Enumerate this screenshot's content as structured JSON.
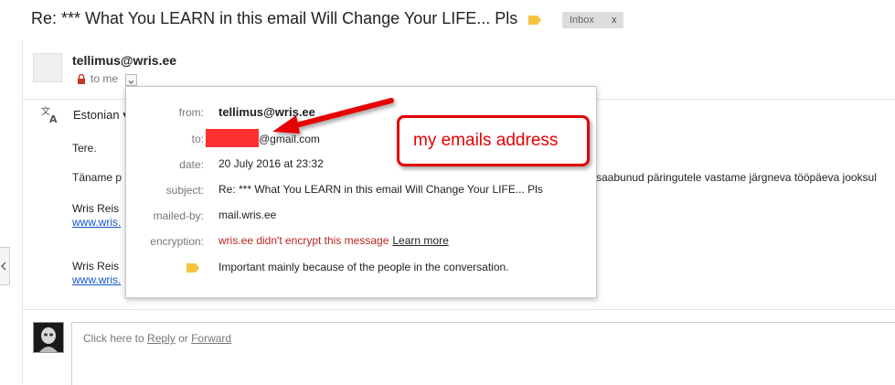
{
  "subject": {
    "title": "Re: *** What You LEARN in this email Will Change Your LIFE... Pls",
    "badge_label": "Inbox",
    "badge_close": "x"
  },
  "header": {
    "sender": "tellimus@wris.ee",
    "to_label": "to me"
  },
  "translate": {
    "language": "Estonian ▾"
  },
  "body": {
    "greeting": "Tere.",
    "line1_start": "Täname p",
    "line1_end": "saabunud päringutele vastame järgneva tööpäeva jooksul",
    "sig1_name": "Wris Reis",
    "sig1_link": "www.wris.",
    "sig2_name": "Wris Reis",
    "sig2_link": "www.wris."
  },
  "details": {
    "from_label": "from:",
    "from_value": "tellimus@wris.ee",
    "to_label": "to:",
    "to_value_suffix": "@gmail.com",
    "date_label": "date:",
    "date_value": "20 July 2016 at 23:32",
    "subject_label": "subject:",
    "subject_value": "Re: *** What You LEARN in this email Will Change Your LIFE... Pls",
    "mailedby_label": "mailed-by:",
    "mailedby_value": "mail.wris.ee",
    "encryption_label": "encryption:",
    "encryption_value": "wris.ee didn't encrypt this message",
    "encryption_link": "Learn more",
    "importance_value": "Important mainly because of the people in the conversation."
  },
  "annotation": {
    "text": "my emails address"
  },
  "reply": {
    "prefix": "Click here to",
    "reply_link": "Reply",
    "or_text": "or",
    "forward_link": "Forward"
  },
  "colors": {
    "accent_red": "#e60000",
    "link_blue": "#1155cc",
    "label_yellow": "#f5c342"
  }
}
